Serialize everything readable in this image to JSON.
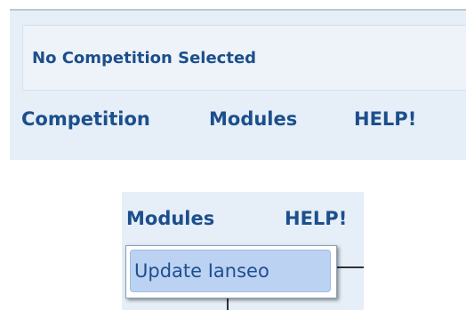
{
  "header": {
    "status": "No Competition Selected"
  },
  "menu": {
    "items": [
      {
        "label": "Competition"
      },
      {
        "label": "Modules"
      },
      {
        "label": "HELP!"
      }
    ]
  },
  "zoom": {
    "menu_items": [
      {
        "label": "Modules"
      },
      {
        "label": "HELP!"
      }
    ],
    "dropdown": {
      "items": [
        {
          "label": "Update Ianseo",
          "highlighted": true
        }
      ]
    }
  },
  "colors": {
    "panel_background": "#e6eef7",
    "menu_text": "#1c4f8c",
    "dropdown_highlight": "#bcd2f2"
  }
}
